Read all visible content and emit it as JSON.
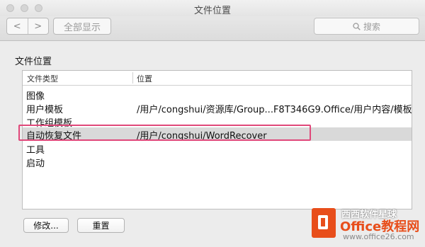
{
  "window": {
    "title": "文件位置"
  },
  "toolbar": {
    "back_label": "<",
    "forward_label": ">",
    "show_all_label": "全部显示",
    "search_placeholder": "搜索"
  },
  "section_title": "文件位置",
  "table": {
    "columns": [
      "文件类型",
      "位置"
    ],
    "rows": [
      {
        "type": "图像",
        "location": ""
      },
      {
        "type": "用户模板",
        "location": "/用户/congshui/资源库/Group...F8T346G9.Office/用户内容/模板"
      },
      {
        "type": "工作组模板",
        "location": ""
      },
      {
        "type": "自动恢复文件",
        "location": "/用户/congshui/WordRecover"
      },
      {
        "type": "工具",
        "location": ""
      },
      {
        "type": "启动",
        "location": ""
      }
    ],
    "selected_row": 3
  },
  "buttons": {
    "modify": "修改...",
    "reset": "重置"
  },
  "watermark": {
    "line1": "西西软件星球",
    "line2": "Office教程网",
    "line3": "www.office26.com"
  },
  "colors": {
    "highlight": "#e0487a",
    "selection": "#d9d9d9",
    "logo": "#e84e1b"
  }
}
